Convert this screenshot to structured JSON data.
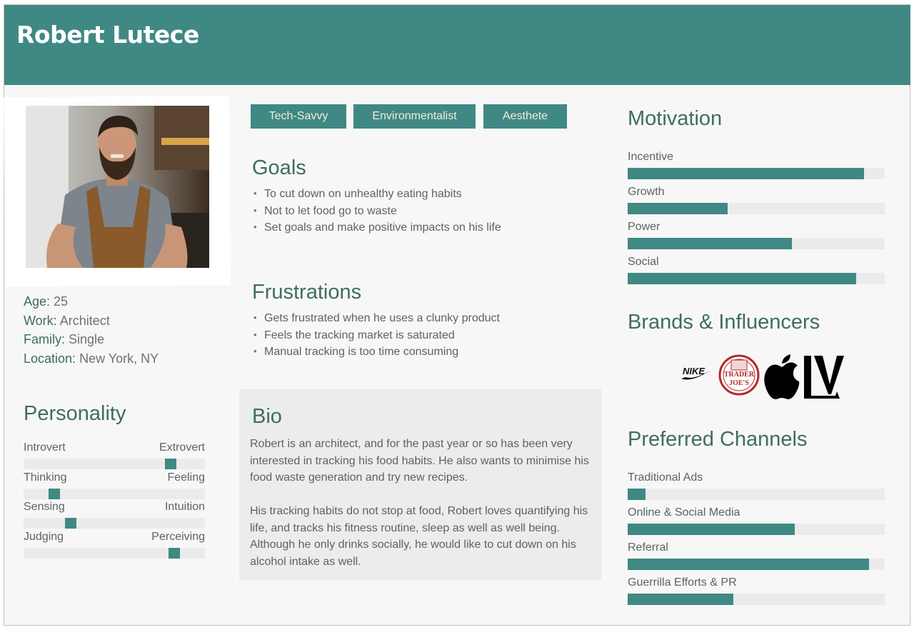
{
  "persona": {
    "name": "Robert Lutece",
    "photo_icon": "portrait-photo",
    "demographics": [
      {
        "key": "Age:",
        "value": "25"
      },
      {
        "key": "Work:",
        "value": "Architect"
      },
      {
        "key": "Family:",
        "value": "Single"
      },
      {
        "key": "Location:",
        "value": "New York, NY"
      }
    ]
  },
  "tags": [
    "Tech-Savvy",
    "Environmentalist",
    "Aesthete"
  ],
  "personality": {
    "title": "Personality",
    "traits": [
      {
        "left": "Introvert",
        "right": "Extrovert",
        "position": 0.81
      },
      {
        "left": "Thinking",
        "right": "Feeling",
        "position": 0.17
      },
      {
        "left": "Sensing",
        "right": "Intuition",
        "position": 0.26
      },
      {
        "left": "Judging",
        "right": "Perceiving",
        "position": 0.83
      }
    ]
  },
  "goals": {
    "title": "Goals",
    "items": [
      "To cut down on unhealthy eating habits",
      "Not to let food go to waste",
      "Set goals and make positive impacts on his life"
    ]
  },
  "frustrations": {
    "title": "Frustrations",
    "items": [
      "Gets frustrated when he uses a clunky product",
      "Feels the tracking market is saturated",
      "Manual tracking is too time consuming"
    ]
  },
  "bio": {
    "title": "Bio",
    "paragraphs": [
      "Robert is an architect, and for the past year or so has been very interested in tracking his food habits. He also wants to minimise his food waste generation and try new recipes.",
      "His tracking habits do not stop at food, Robert loves quantifying his life, and tracks his fitness routine, sleep as well as well being. Although he only drinks socially, he would like to cut down on his alcohol intake as well."
    ]
  },
  "motivation": {
    "title": "Motivation",
    "items": [
      {
        "label": "Incentive",
        "value": 0.92
      },
      {
        "label": "Growth",
        "value": 0.39
      },
      {
        "label": "Power",
        "value": 0.64
      },
      {
        "label": "Social",
        "value": 0.89
      }
    ]
  },
  "brands": {
    "title": "Brands & Influencers",
    "logos": [
      {
        "icon": "nike-logo",
        "text": "NIKE"
      },
      {
        "icon": "trader-joes-logo",
        "text": "TRADER JOE'S"
      },
      {
        "icon": "apple-logo",
        "text": ""
      },
      {
        "icon": "louis-vuitton-logo",
        "text": "LV"
      }
    ]
  },
  "channels": {
    "title": "Preferred Channels",
    "items": [
      {
        "label": "Traditional Ads",
        "value": 0.07
      },
      {
        "label": "Online & Social Media",
        "value": 0.65
      },
      {
        "label": "Referral",
        "value": 0.94
      },
      {
        "label": "Guerrilla Efforts & PR",
        "value": 0.41
      }
    ]
  },
  "colors": {
    "accent": "#408883",
    "heading": "#3f6d62",
    "text": "#5a6460",
    "track": "#ebebeb",
    "panel": "#ececec"
  }
}
